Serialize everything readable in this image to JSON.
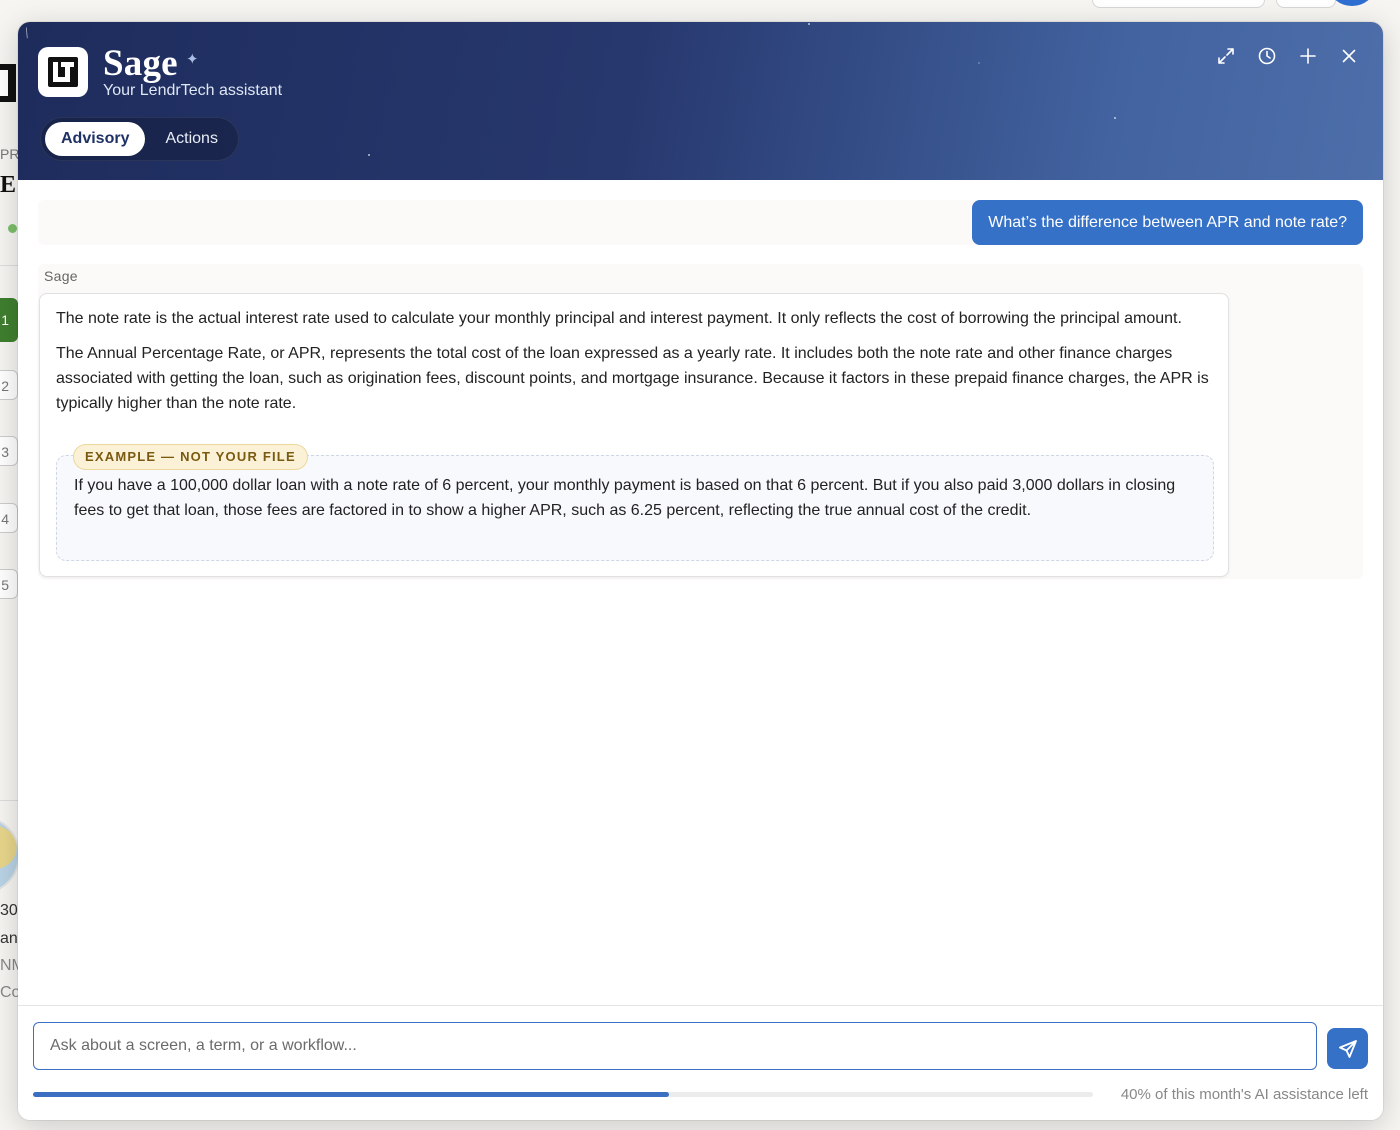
{
  "background": {
    "fragment_pr": "PR",
    "fragment_heading": "E",
    "steps": [
      "1",
      "2",
      "3",
      "4",
      "5"
    ],
    "lines": [
      "30",
      "an",
      "NM",
      "Co"
    ]
  },
  "assistant": {
    "name": "Sage",
    "subtitle": "Your LendrTech assistant",
    "tabs": [
      {
        "label": "Advisory",
        "active": true
      },
      {
        "label": "Actions",
        "active": false
      }
    ],
    "header_icons": [
      "expand-icon",
      "history-icon",
      "new-chat-icon",
      "close-icon"
    ]
  },
  "conversation": {
    "user_message": "What’s the difference between APR and note rate?",
    "sender_label": "Sage",
    "answer_paragraphs": [
      "The note rate is the actual interest rate used to calculate your monthly principal and interest payment. It only reflects the cost of borrowing the principal amount.",
      "The Annual Percentage Rate, or APR, represents the total cost of the loan expressed as a yearly rate. It includes both the note rate and other finance charges associated with getting the loan, such as origination fees, discount points, and mortgage insurance. Because it factors in these prepaid finance charges, the APR is typically higher than the note rate."
    ],
    "example_badge": "EXAMPLE — NOT YOUR FILE",
    "example_text": "If you have a 100,000 dollar loan with a note rate of 6 percent, your monthly payment is based on that 6 percent. But if you also paid 3,000 dollars in closing fees to get that loan, those fees are factored in to show a higher APR, such as 6.25 percent, reflecting the true annual cost of the credit."
  },
  "composer": {
    "placeholder": "Ask about a screen, a term, or a workflow...",
    "value": "",
    "usage_fraction": 0.6,
    "usage_text": "40% of this month's AI assistance left"
  },
  "colors": {
    "accent": "#3671c8",
    "header_dark": "#1e2c5c",
    "badge_bg": "#fbf1d6"
  }
}
